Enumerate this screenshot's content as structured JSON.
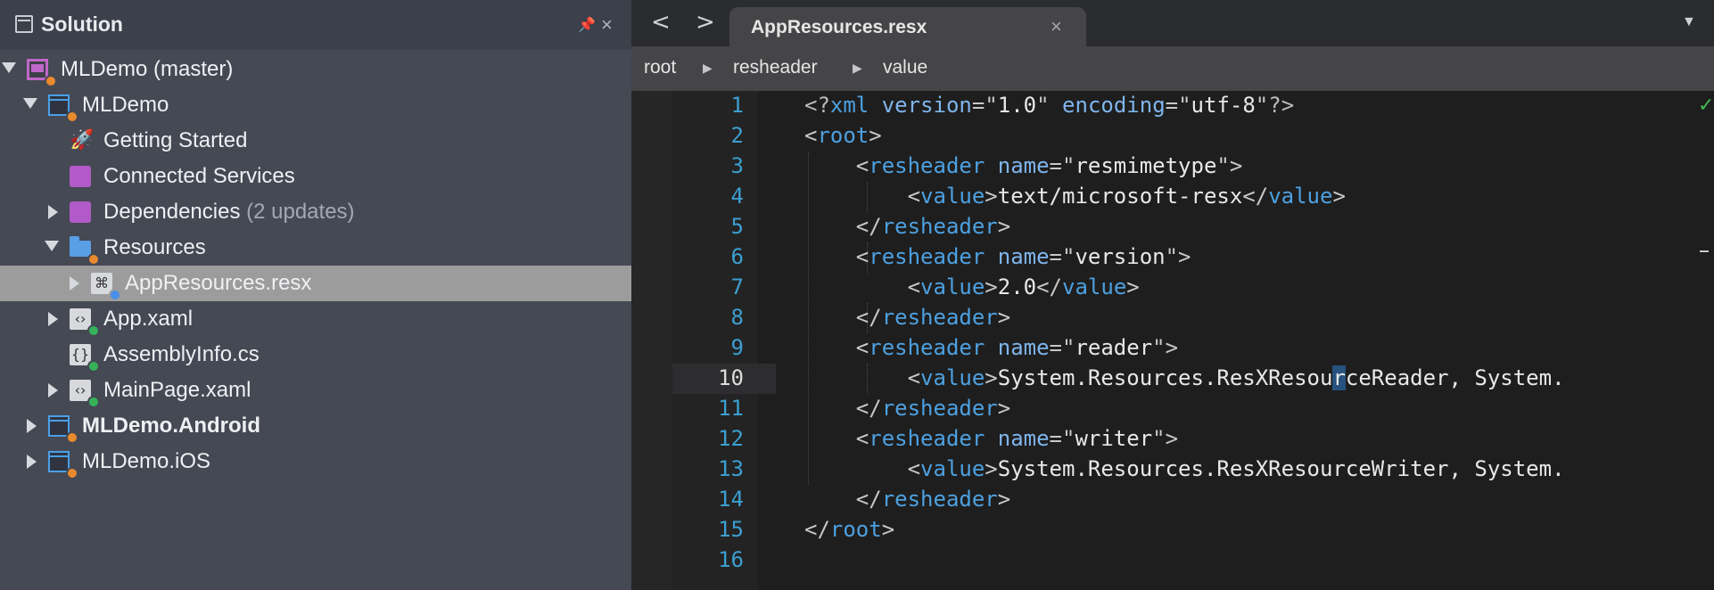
{
  "solution_pad": {
    "title": "Solution",
    "tree": [
      {
        "label": "MLDemo (master)",
        "note": "",
        "bold": false,
        "arrow": "down",
        "icon": "solution-icon",
        "badge": "orange"
      },
      {
        "label": "MLDemo",
        "note": "",
        "bold": false,
        "arrow": "down",
        "icon": "project-icon",
        "badge": "orange"
      },
      {
        "label": "Getting Started",
        "note": "",
        "bold": false,
        "arrow": "none",
        "icon": "rocket-icon",
        "badge": "none"
      },
      {
        "label": "Connected Services",
        "note": "",
        "bold": false,
        "arrow": "none",
        "icon": "connected-services-icon",
        "badge": "none"
      },
      {
        "label": "Dependencies",
        "note": "(2 updates)",
        "bold": false,
        "arrow": "right",
        "icon": "dependencies-icon",
        "badge": "none"
      },
      {
        "label": "Resources",
        "note": "",
        "bold": false,
        "arrow": "down",
        "icon": "folder-icon",
        "badge": "orange"
      },
      {
        "label": "AppResources.resx",
        "note": "",
        "bold": false,
        "arrow": "right",
        "icon": "resx-file-icon",
        "badge": "blue",
        "selected": true
      },
      {
        "label": "App.xaml",
        "note": "",
        "bold": false,
        "arrow": "right",
        "icon": "xaml-file-icon",
        "badge": "green"
      },
      {
        "label": "AssemblyInfo.cs",
        "note": "",
        "bold": false,
        "arrow": "none",
        "icon": "cs-file-icon",
        "badge": "green"
      },
      {
        "label": "MainPage.xaml",
        "note": "",
        "bold": false,
        "arrow": "right",
        "icon": "xaml-file-icon",
        "badge": "green"
      },
      {
        "label": "MLDemo.Android",
        "note": "",
        "bold": true,
        "arrow": "right",
        "icon": "project-icon",
        "badge": "orange"
      },
      {
        "label": "MLDemo.iOS",
        "note": "",
        "bold": false,
        "arrow": "right",
        "icon": "project-icon",
        "badge": "orange"
      }
    ]
  },
  "editor": {
    "tab_label": "AppResources.resx",
    "back_glyph": "<",
    "forward_glyph": ">",
    "breadcrumb": [
      "root",
      "resheader",
      "value"
    ],
    "current_line": 10,
    "line_numbers": [
      "1",
      "2",
      "3",
      "4",
      "5",
      "6",
      "7",
      "8",
      "9",
      "10",
      "11",
      "12",
      "13",
      "14",
      "15",
      "16"
    ],
    "xml_decl": {
      "version": "1.0",
      "encoding": "utf-8"
    },
    "root_tag": "root",
    "headers": [
      {
        "name": "resmimetype",
        "value": "text/microsoft-resx"
      },
      {
        "name": "version",
        "value": "2.0"
      },
      {
        "name": "reader",
        "value_before_cursor": "System.Resources.ResXResou",
        "value_cursor": "r",
        "value_after_cursor": "ceReader, System."
      },
      {
        "name": "writer",
        "value": "System.Resources.ResXResourceWriter, System."
      }
    ],
    "status_icon": "check-icon"
  },
  "colors": {
    "pad_bg": "#454954",
    "selection_bg": "#9c9c9c",
    "editor_bg": "#1e1e1e",
    "line_number": "#3c9fd0",
    "xml_tag": "#4da0e0",
    "status_ok": "#3fb950"
  }
}
